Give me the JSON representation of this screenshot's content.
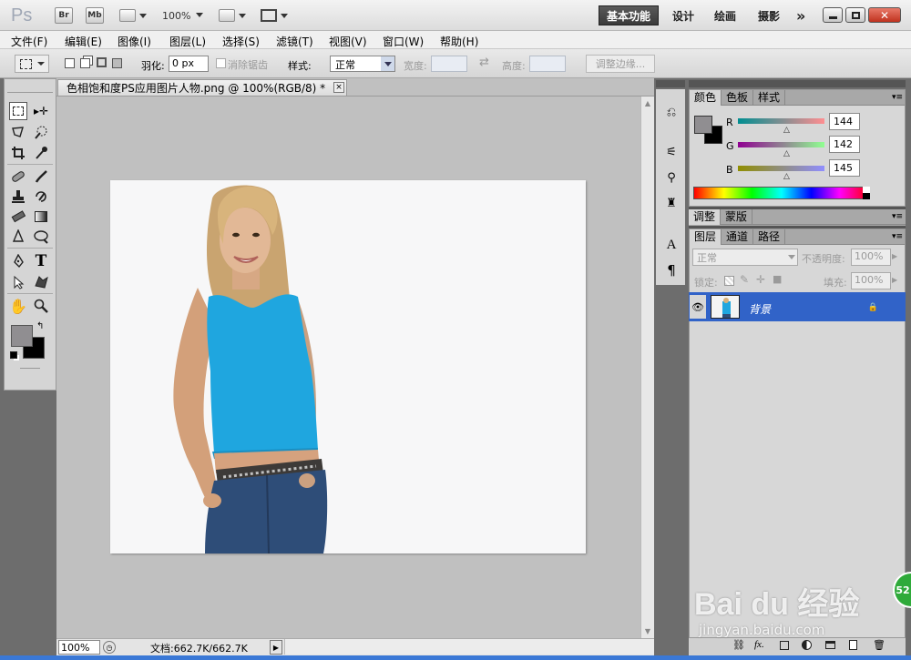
{
  "app": {
    "logo": "Ps",
    "bridge_label": "Br",
    "minibridge_label": "Mb",
    "zoom": "100%"
  },
  "workspaces": {
    "essentials": "基本功能",
    "design": "设计",
    "painting": "绘画",
    "photography": "摄影",
    "more": "»"
  },
  "menu": [
    "文件(F)",
    "编辑(E)",
    "图像(I)",
    "图层(L)",
    "选择(S)",
    "滤镜(T)",
    "视图(V)",
    "窗口(W)",
    "帮助(H)"
  ],
  "options": {
    "feather_label": "羽化:",
    "feather_value": "0 px",
    "antialias_label": "消除锯齿",
    "style_label": "样式:",
    "style_value": "正常",
    "width_label": "宽度:",
    "height_label": "高度:",
    "refine_edge": "调整边缘..."
  },
  "document": {
    "tab_title": "色相饱和度PS应用图片人物.png @ 100%(RGB/8) *",
    "close": "×"
  },
  "status": {
    "zoom": "100%",
    "doc_info": "文档:662.7K/662.7K"
  },
  "color_panel": {
    "tabs": [
      "颜色",
      "色板",
      "样式"
    ],
    "r_label": "R",
    "g_label": "G",
    "b_label": "B",
    "r": 144,
    "g": 142,
    "b": 145,
    "fg_color": "#908e91",
    "bg_color": "#000000"
  },
  "adjust_panel": {
    "tabs": [
      "调整",
      "蒙版"
    ]
  },
  "layers_panel": {
    "tabs": [
      "图层",
      "通道",
      "路径"
    ],
    "blend_mode": "正常",
    "opacity_label": "不透明度:",
    "opacity": "100%",
    "lock_label": "锁定:",
    "fill_label": "填充:",
    "fill": "100%",
    "layer_name": "背景"
  },
  "watermark": {
    "brand": "Bai du 经验",
    "url": "jingyan.baidu.com",
    "badge": "52"
  }
}
